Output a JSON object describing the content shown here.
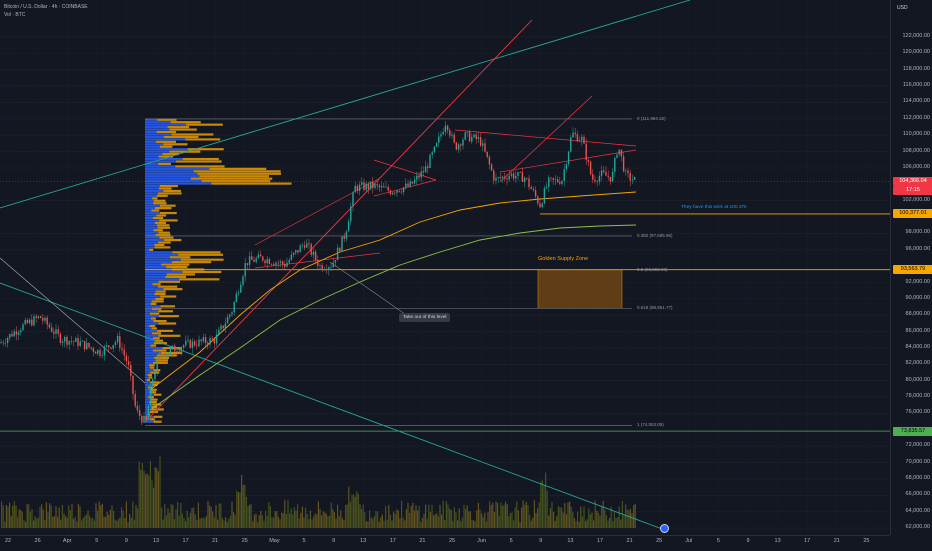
{
  "legend": {
    "title": "Bitcoin / U.S. Dollar · 4h · COINBASE",
    "volume": "Vol · BTC"
  },
  "price_axis": {
    "currency": "USD",
    "ticks": [
      "122,000.00",
      "120,000.00",
      "118,000.00",
      "116,000.00",
      "114,000.00",
      "112,000.00",
      "110,000.00",
      "108,000.00",
      "106,000.00",
      "102,000.00",
      "98,000.00",
      "96,000.00",
      "92,000.00",
      "90,000.00",
      "88,000.00",
      "86,000.00",
      "84,000.00",
      "82,000.00",
      "80,000.00",
      "78,000.00",
      "76,000.00",
      "72,000.00",
      "70,000.00",
      "68,000.00",
      "66,000.00",
      "64,000.00",
      "62,000.00"
    ],
    "tick_values": [
      122000,
      120000,
      118000,
      116000,
      114000,
      112000,
      110000,
      108000,
      106000,
      102000,
      98000,
      96000,
      92000,
      90000,
      88000,
      86000,
      84000,
      82000,
      80000,
      78000,
      76000,
      72000,
      70000,
      68000,
      66000,
      64000,
      62000
    ]
  },
  "price_tags": [
    {
      "text": "104,366.04",
      "sub": "17:15",
      "value": 104366,
      "color": "#f23645",
      "text_color": "#ffffff"
    },
    {
      "text": "100,377.01",
      "value": 100377,
      "color": "#f7a600",
      "text_color": "#000000"
    },
    {
      "text": "93,563.79",
      "value": 93564,
      "color": "#f7a600",
      "text_color": "#000000"
    },
    {
      "text": "73,835.57",
      "value": 73836,
      "color": "#4caf50",
      "text_color": "#000000"
    }
  ],
  "time_axis": {
    "labels": [
      "22",
      "26",
      "Apr",
      "5",
      "9",
      "13",
      "17",
      "21",
      "25",
      "May",
      "5",
      "9",
      "13",
      "17",
      "21",
      "25",
      "Jun",
      "5",
      "9",
      "13",
      "17",
      "21",
      "25",
      "Jul",
      "5",
      "9",
      "13",
      "17",
      "21",
      "25"
    ]
  },
  "fib_levels": [
    {
      "label": "0 (111,984.32)",
      "value": 111984
    },
    {
      "label": "0.382 (97,685.96)",
      "value": 97686
    },
    {
      "label": "0.5 (93,558.90)",
      "value": 93559
    },
    {
      "label": "0.618 (88,851.77)",
      "value": 88852
    },
    {
      "label": "1 (74,553.05)",
      "value": 74553
    }
  ],
  "annotations": {
    "golden_zone": "Golden Supply Zone",
    "wick_note": "They have this wick at 100.37k",
    "callout": "Take out of this level"
  },
  "colors": {
    "background": "#131722",
    "up_candle": "#26a69a",
    "down_candle": "#ef5350",
    "fib_line": "#787b86",
    "orange": "#f7a600",
    "green_line": "#4caf50",
    "teal_line": "#26a69a",
    "red_line": "#f23645",
    "profile_blue": "#2962ff",
    "profile_yellow": "#f7a600",
    "annotation_blue": "#2196f3"
  }
}
